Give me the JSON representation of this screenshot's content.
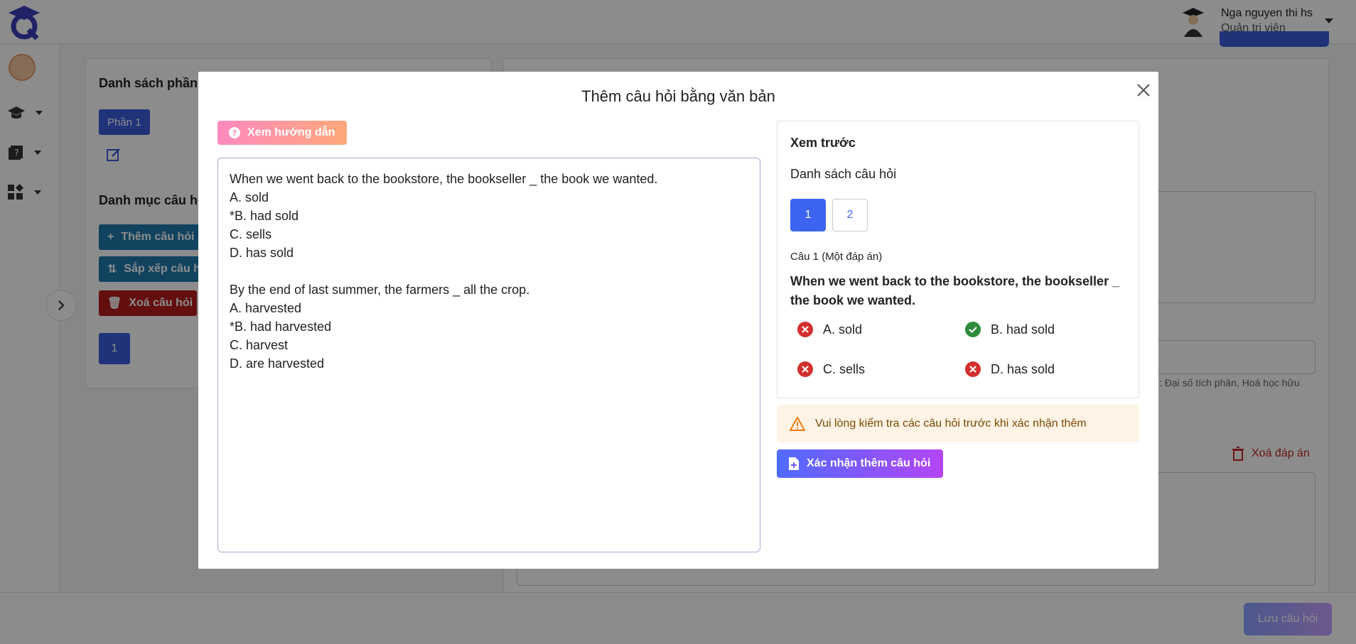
{
  "header": {
    "user_name": "Nga nguyen thi hs",
    "user_role": "Quản trị viên"
  },
  "left_panel": {
    "section_title": "Danh sách phần",
    "part_button": "Phần 1",
    "category_title": "Danh mục câu hỏi",
    "add_question": "Thêm câu hỏi",
    "sort_questions": "Sắp xếp câu hỏi",
    "delete_question": "Xoá câu hỏi",
    "page_number": "1"
  },
  "right_panel": {
    "hint_text": ": Đại số tích phân, Hoá học hữu",
    "delete_answer": "Xoá đáp án"
  },
  "footer": {
    "save_button": "Lưu câu hỏi"
  },
  "modal": {
    "title": "Thêm câu hỏi bằng văn bản",
    "guide_button": "Xem hướng dẫn",
    "input_text": "When we went back to the bookstore, the bookseller _ the book we wanted.\nA. sold\n*B. had sold\nC. sells\nD. has sold\n\nBy the end of last summer, the farmers _ all the crop.\nA. harvested\n*B. had harvested\nC. harvest\nD. are harvested",
    "preview": {
      "title": "Xem trước",
      "list_title": "Danh sách câu hỏi",
      "pages": [
        "1",
        "2"
      ],
      "question_label": "Câu 1 (Một đáp án)",
      "question_text": "When we went back to the bookstore, the bookseller _ the book we wanted.",
      "options": [
        {
          "label": "A. sold",
          "correct": false
        },
        {
          "label": "B. had sold",
          "correct": true
        },
        {
          "label": "C. sells",
          "correct": false
        },
        {
          "label": "D. has sold",
          "correct": false
        }
      ]
    },
    "warning": "Vui lòng kiểm tra các câu hỏi trước khi xác nhận thêm",
    "confirm_button": "Xác nhận thêm câu hỏi"
  },
  "colors": {
    "primary": "#3c64f0",
    "correct": "#2e8b3a",
    "wrong": "#d32f2f",
    "warning_bg": "#fff3e6"
  }
}
